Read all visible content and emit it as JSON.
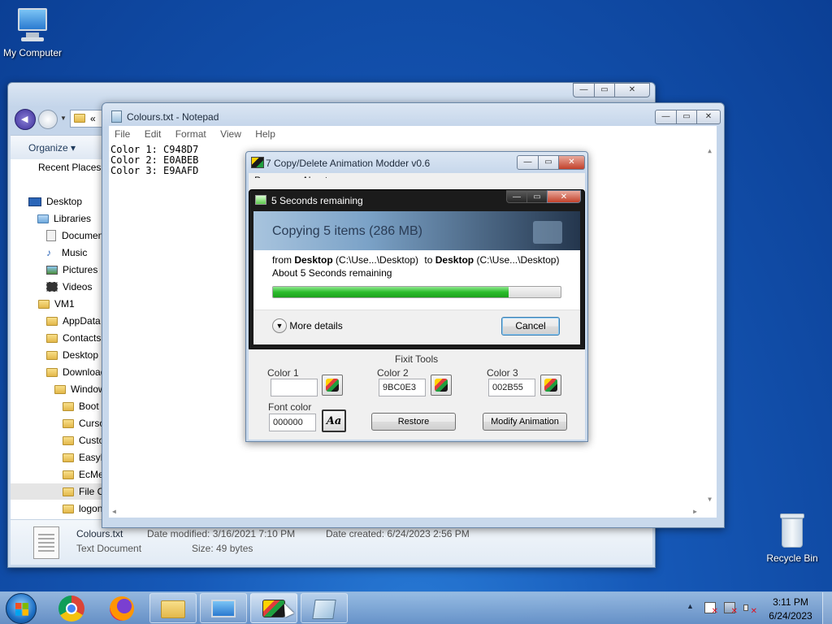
{
  "desktop": {
    "icons": [
      {
        "label": "My Computer"
      },
      {
        "label": "Recycle Bin"
      }
    ]
  },
  "explorer": {
    "address_overflow": "«",
    "toolbar": {
      "organize": "Organize ▾"
    },
    "tree": [
      "Recent Places",
      "Desktop",
      "Libraries",
      "Documents",
      "Music",
      "Pictures",
      "Videos",
      "VM1",
      "AppData",
      "Contacts",
      "Desktop",
      "Downloads",
      "Windows",
      "Boot",
      "Cursors",
      "Custom",
      "EasyB",
      "EcMe",
      "File C",
      "logon"
    ],
    "details": {
      "filename": "Colours.txt",
      "type": "Text Document",
      "date_modified": "Date modified: 3/16/2021 7:10 PM",
      "date_created": "Date created: 6/24/2023 2:56 PM",
      "size": "Size: 49 bytes"
    }
  },
  "notepad": {
    "title": "Colours.txt - Notepad",
    "menu": [
      "File",
      "Edit",
      "Format",
      "View",
      "Help"
    ],
    "lines": [
      "Color 1: C948D7",
      "Color 2: E0ABEB",
      "Color 3: E9AAFD"
    ]
  },
  "modder": {
    "title": "7 Copy/Delete Animation Modder v0.6",
    "menu": [
      "Program",
      "About"
    ],
    "fixit_label": "Fixit Tools",
    "color1": {
      "label": "Color 1",
      "value": ""
    },
    "color2": {
      "label": "Color 2",
      "value": "9BC0E3"
    },
    "color3": {
      "label": "Color 3",
      "value": "002B55"
    },
    "font_color": {
      "label": "Font color",
      "value": "000000"
    },
    "font_button": "Aa",
    "restore": "Restore",
    "modify": "Modify Animation"
  },
  "copy_dialog": {
    "title": "5 Seconds remaining",
    "heading": "Copying 5 items (286 MB)",
    "from_prefix": "from",
    "from_name": "Desktop",
    "from_path": "(C:\\Use...\\Desktop)",
    "to_prefix": "to",
    "to_name": "Desktop",
    "to_path": "(C:\\Use...\\Desktop)",
    "remaining": "About 5 Seconds remaining",
    "progress": 0.82,
    "more_details": "More details",
    "cancel": "Cancel"
  },
  "taskbar": {
    "time": "3:11 PM",
    "date": "6/24/2023"
  },
  "colors": {
    "progress_green": "#2cbc2c",
    "close_red": "#c2412b"
  }
}
